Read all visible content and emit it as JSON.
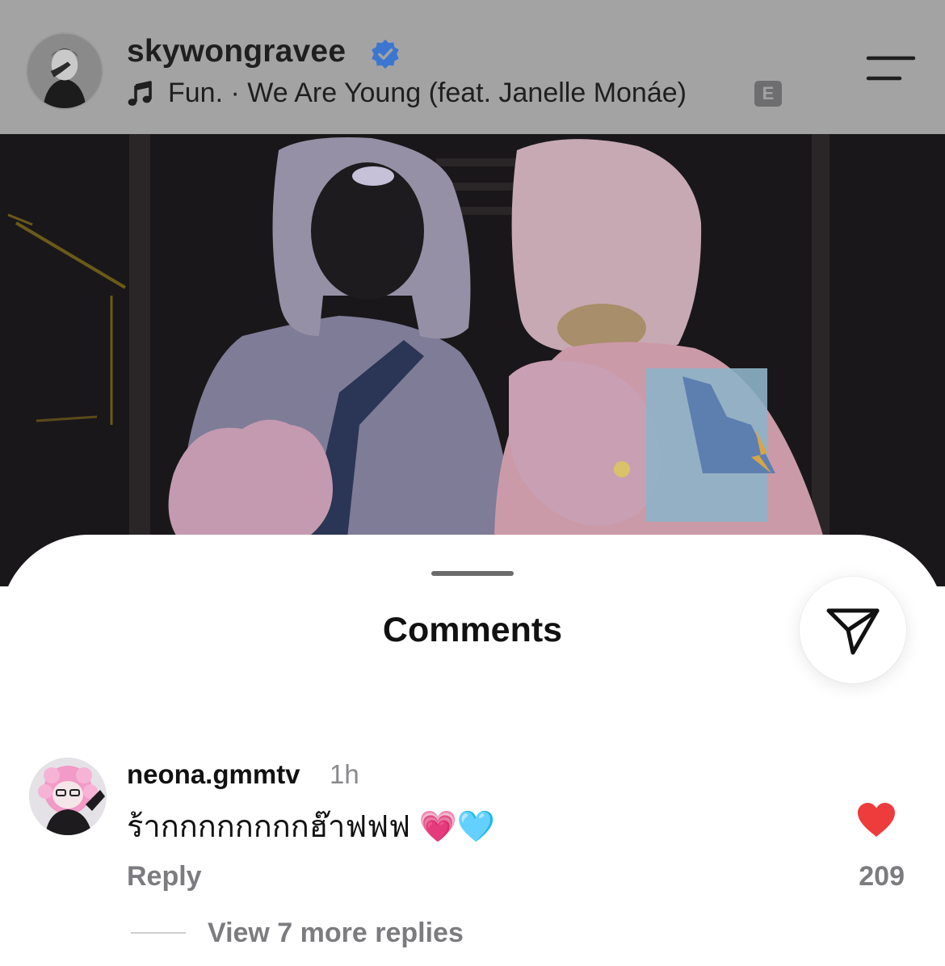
{
  "header": {
    "username": "skywongravee",
    "verified": true,
    "track": "Fun. · We Are Young (feat. Janelle Monáe)",
    "explicit_badge": "E"
  },
  "sheet": {
    "title": "Comments"
  },
  "comments": [
    {
      "username": "neona.gmmtv",
      "time": "1h",
      "text": "ร้ากกกกกกกกฮ๊าฟฟฟ 💗🩵",
      "reply_label": "Reply",
      "likes": "209",
      "liked": true,
      "view_replies_label": "View 7 more replies"
    }
  ],
  "colors": {
    "dim_overlay": "#a3a3a4",
    "verified_blue": "#3d76d1",
    "like_red": "#ee3b3b",
    "secondary_text": "#7c7c80"
  },
  "icons": {
    "verified": "verified-badge-icon",
    "music": "music-note-icon",
    "menu": "menu-icon",
    "share": "paper-plane-icon",
    "like": "heart-icon"
  }
}
